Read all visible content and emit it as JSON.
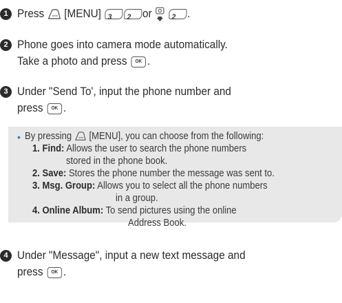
{
  "steps": [
    {
      "num": "1",
      "press": "Press",
      "menu": "[MENU]",
      "key1": "3",
      "key2": "2",
      "or": "or",
      "key3": "2",
      "end": "."
    },
    {
      "num": "2",
      "line1": "Phone goes into camera mode automatically.",
      "line2_start": "Take a photo and press",
      "ok_key": "OK",
      "end": "."
    },
    {
      "num": "3",
      "line1": "Under \"Send To', input the phone number and",
      "line2_start": "press",
      "ok_key": "OK",
      "end": "."
    },
    {
      "num": "4",
      "line1": "Under \"Message\", input a new text message and",
      "line2_start": "press",
      "ok_key": "OK",
      "end": "."
    }
  ],
  "note": {
    "bullet": "•",
    "intro_start": "By pressing",
    "intro_end": "[MENU], you can choose from the following:",
    "items": [
      {
        "label": "1. Find:",
        "text": "Allows the user to search the phone numbers",
        "cont": "stored in the phone book."
      },
      {
        "label": "2. Save:",
        "text": "Stores the phone number the message was sent to.",
        "cont": ""
      },
      {
        "label": "3. Msg. Group:",
        "text": "Allows you to select all the phone numbers",
        "cont": "in a group."
      },
      {
        "label": "4. Online Album:",
        "text": "To send pictures using the online",
        "cont": "Address Book."
      }
    ]
  },
  "colors": {
    "badge": "#2b2b2b",
    "note_bg": "#e8e8e8",
    "bullet": "#2d7fb8"
  },
  "icons": [
    "soft-key-icon",
    "number-key-3-icon",
    "number-key-2-icon",
    "camera-down-icon",
    "ok-key-icon"
  ]
}
